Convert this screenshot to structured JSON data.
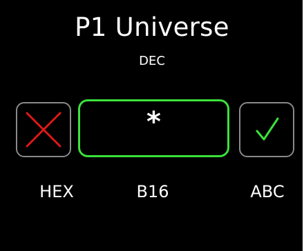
{
  "header": {
    "title": "P1 Universe",
    "subtitle": "DEC"
  },
  "entry": {
    "value": "*"
  },
  "buttons": {
    "cancel_icon": "close-icon",
    "confirm_icon": "check-icon"
  },
  "modes": {
    "left": "HEX",
    "center": "B16",
    "right": "ABC"
  },
  "colors": {
    "background": "#000000",
    "text": "#ffffff",
    "accent_green": "#3be23b",
    "cancel_red": "#e01818",
    "button_border": "#8a8a8a"
  }
}
